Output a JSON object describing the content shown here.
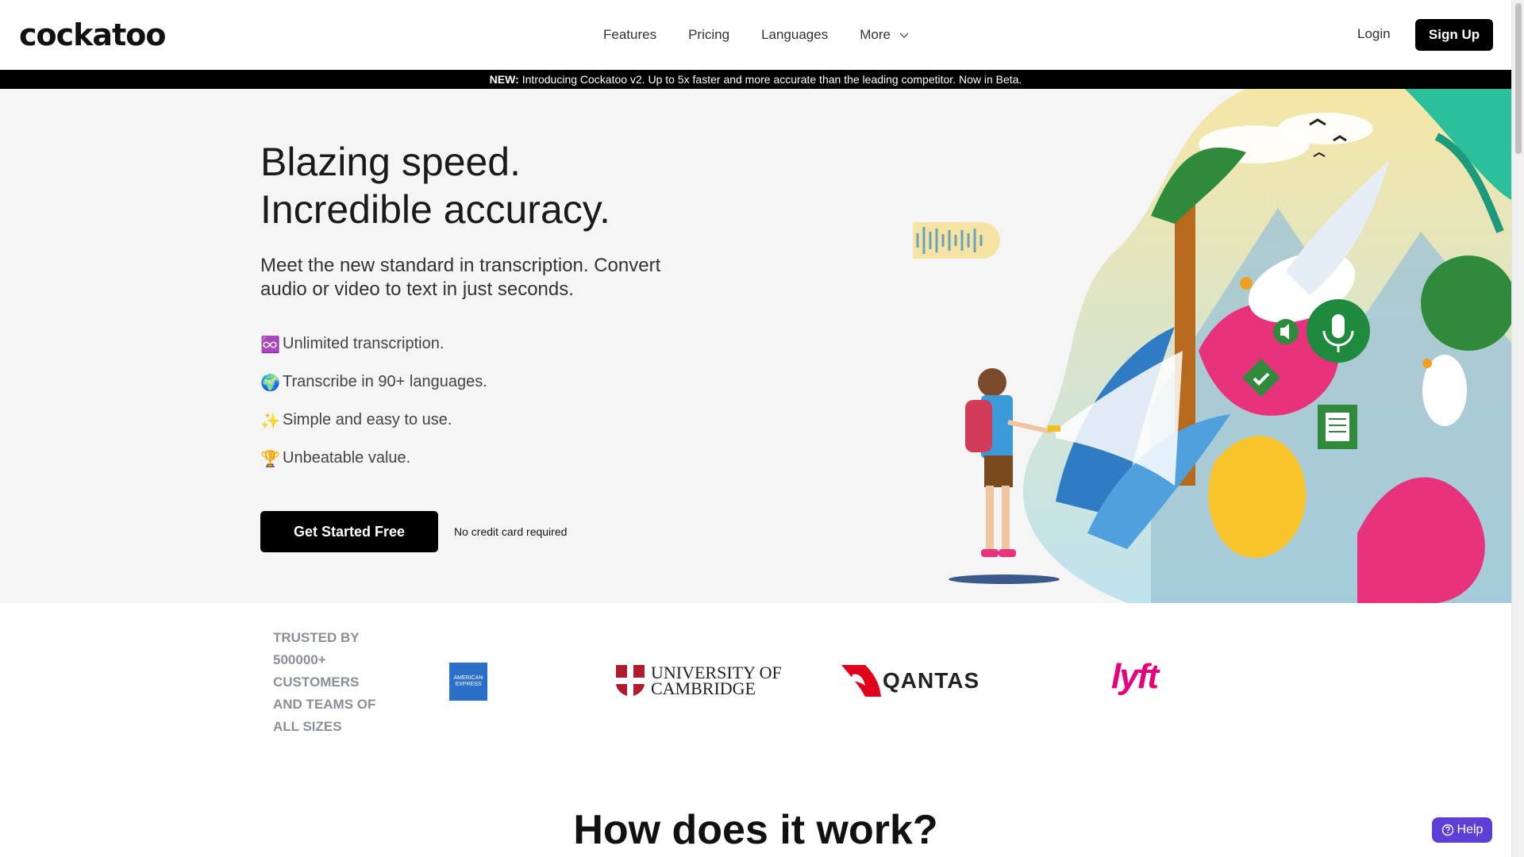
{
  "header": {
    "logo": "cockatoo",
    "nav": [
      {
        "label": "Features"
      },
      {
        "label": "Pricing"
      },
      {
        "label": "Languages"
      },
      {
        "label": "More"
      }
    ],
    "login": "Login",
    "signup": "Sign Up"
  },
  "banner": {
    "prefix": "NEW:",
    "text": "Introducing Cockatoo v2. Up to 5x faster and more accurate than the leading competitor. Now in Beta."
  },
  "hero": {
    "title_line1": "Blazing speed.",
    "title_line2": "Incredible accuracy.",
    "subtitle": "Meet the new standard in transcription. Convert audio or video to text in just seconds.",
    "features": [
      {
        "icon": "♾️",
        "text": "Unlimited transcription."
      },
      {
        "icon": "🌍",
        "text": "Transcribe in 90+ languages."
      },
      {
        "icon": "✨",
        "text": "Simple and easy to use."
      },
      {
        "icon": "🏆",
        "text": "Unbeatable value."
      }
    ],
    "cta": "Get Started Free",
    "cta_note": "No credit card required"
  },
  "trusted": {
    "text": "TRUSTED BY 500000+ CUSTOMERS AND TEAMS OF ALL SIZES",
    "logos": {
      "amex": "AMERICAN EXPRESS",
      "cambridge_line1": "UNIVERSITY OF",
      "cambridge_line2": "CAMBRIDGE",
      "qantas": "QANTAS",
      "lyft": "lyft"
    }
  },
  "section_title": "How does it work?",
  "help": "Help",
  "colors": {
    "primary": "#000000",
    "help": "#5b3fd6",
    "lyft": "#e5007d",
    "qantas": "#e0001b"
  }
}
